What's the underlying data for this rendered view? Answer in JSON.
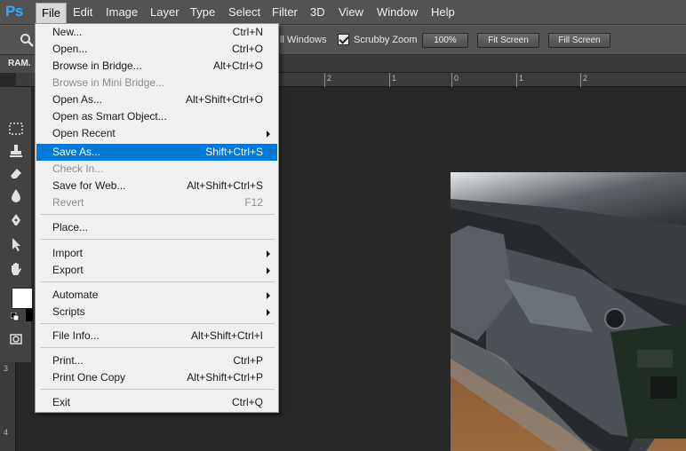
{
  "app": {
    "logo": "Ps"
  },
  "menubar": {
    "items": [
      {
        "label": "File"
      },
      {
        "label": "Edit"
      },
      {
        "label": "Image"
      },
      {
        "label": "Layer"
      },
      {
        "label": "Type"
      },
      {
        "label": "Select"
      },
      {
        "label": "Filter"
      },
      {
        "label": "3D"
      },
      {
        "label": "View"
      },
      {
        "label": "Window"
      },
      {
        "label": "Help"
      }
    ]
  },
  "options": {
    "all_windows": "ll Windows",
    "scrubby_zoom": "Scrubby Zoom",
    "scrubby_checked": true,
    "zoom_100": "100%",
    "fit_screen": "Fit Screen",
    "fill_screen": "Fill Screen"
  },
  "document": {
    "tab_label": "RAM."
  },
  "ruler": {
    "horizontal": [
      "2",
      "1",
      "0",
      "1",
      "2"
    ],
    "vertical": [
      "3",
      "4"
    ]
  },
  "file_menu": {
    "items": [
      {
        "label": "New...",
        "shortcut": "Ctrl+N"
      },
      {
        "label": "Open...",
        "shortcut": "Ctrl+O"
      },
      {
        "label": "Browse in Bridge...",
        "shortcut": "Alt+Ctrl+O"
      },
      {
        "label": "Browse in Mini Bridge...",
        "shortcut": "",
        "disabled": true
      },
      {
        "label": "Open As...",
        "shortcut": "Alt+Shift+Ctrl+O"
      },
      {
        "label": "Open as Smart Object...",
        "shortcut": ""
      },
      {
        "label": "Open Recent",
        "shortcut": "",
        "submenu": true
      },
      {
        "label": "Save As...",
        "shortcut": "Shift+Ctrl+S",
        "highlighted": true
      },
      {
        "label": "Check In...",
        "shortcut": "",
        "disabled": true
      },
      {
        "label": "Save for Web...",
        "shortcut": "Alt+Shift+Ctrl+S"
      },
      {
        "label": "Revert",
        "shortcut": "F12",
        "disabled": true
      },
      {
        "label": "Place...",
        "shortcut": ""
      },
      {
        "label": "Import",
        "shortcut": "",
        "submenu": true
      },
      {
        "label": "Export",
        "shortcut": "",
        "submenu": true
      },
      {
        "label": "Automate",
        "shortcut": "",
        "submenu": true
      },
      {
        "label": "Scripts",
        "shortcut": "",
        "submenu": true
      },
      {
        "label": "File Info...",
        "shortcut": "Alt+Shift+Ctrl+I"
      },
      {
        "label": "Print...",
        "shortcut": "Ctrl+P"
      },
      {
        "label": "Print One Copy",
        "shortcut": "Alt+Shift+Ctrl+P"
      },
      {
        "label": "Exit",
        "shortcut": "Ctrl+Q"
      }
    ]
  },
  "colors": {
    "accent": "#0078d7",
    "menubar": "#535353",
    "workspace": "#282828"
  }
}
